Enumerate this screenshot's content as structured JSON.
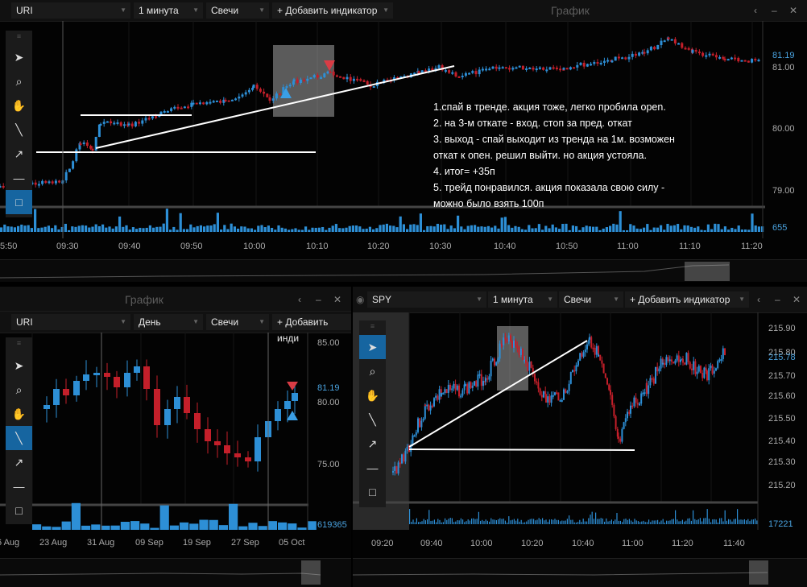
{
  "top_chart": {
    "header": {
      "symbol": "URI",
      "interval": "1 минута",
      "type": "Свечи",
      "indicator": "+ Добавить индикатор",
      "title": "График"
    },
    "y_labels": [
      "81.19",
      "81.00",
      "80.00",
      "79.00",
      "655"
    ],
    "x_labels": [
      "5:50",
      "09:30",
      "09:40",
      "09:50",
      "10:00",
      "10:10",
      "10:20",
      "10:30",
      "10:40",
      "10:50",
      "11:00",
      "11:10",
      "11:20"
    ],
    "annotation": [
      "1.спай в тренде. акция тоже, легко пробила  open.",
      "2. на 3-м откате - вход. стоп за пред. откат",
      "3. выход - спай выходит из тренда на 1м. возможен",
      "откат к опен. решил выйти. но акция устояла.",
      "4. итог= +35п",
      "5. трейд понравился. акция показала свою силу -",
      "можно было взять 100п"
    ]
  },
  "bottom_left_chart": {
    "header": {
      "title": "График",
      "symbol": "URI",
      "interval": "День",
      "type": "Свечи",
      "indicator": "+ Добавить инди"
    },
    "y_labels": [
      "85.00",
      "81.19",
      "80.00",
      "75.00",
      "619365"
    ],
    "x_labels": [
      "6 Aug",
      "23 Aug",
      "31 Aug",
      "09 Sep",
      "19 Sep",
      "27 Sep",
      "05 Oct"
    ]
  },
  "bottom_right_chart": {
    "header": {
      "symbol": "SPY",
      "interval": "1 минута",
      "type": "Свечи",
      "indicator": "+ Добавить индикатор"
    },
    "y_labels": [
      "215.90",
      "215.80",
      "215.78",
      "215.70",
      "215.60",
      "215.50",
      "215.40",
      "215.30",
      "215.20",
      "17221"
    ],
    "x_labels": [
      "09:20",
      "09:40",
      "10:00",
      "10:20",
      "10:40",
      "11:00",
      "11:20",
      "11:40"
    ]
  },
  "controls": {
    "back": "‹",
    "minimize": "–",
    "close": "✕"
  },
  "icons": {
    "menu": "menu-grip-icon",
    "cursor": "cursor-arrow-icon",
    "zoom": "magnifier-icon",
    "pan": "hand-icon",
    "line": "trend-line-icon",
    "arrow": "arrow-icon",
    "hline": "horizontal-line-icon",
    "rect": "rectangle-icon"
  },
  "colors": {
    "up": "#2d8fd6",
    "down": "#c41f2a",
    "accent": "#1665a0"
  }
}
